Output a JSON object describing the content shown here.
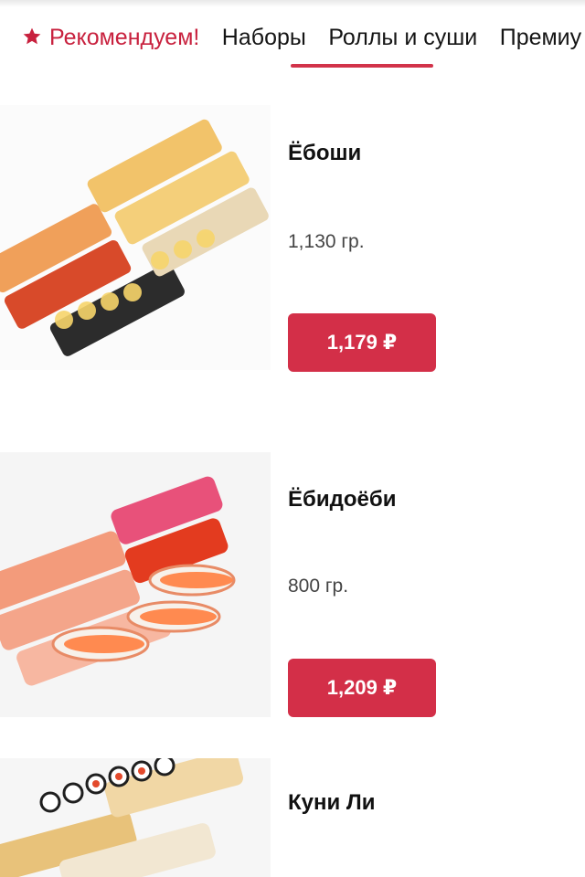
{
  "nav": {
    "tabs": [
      {
        "label": "Рекомендуем!",
        "active": true,
        "icon": "star-icon"
      },
      {
        "label": "Наборы",
        "active": false
      },
      {
        "label": "Роллы и суши",
        "active": false
      },
      {
        "label": "Премиу",
        "active": false
      }
    ]
  },
  "products": [
    {
      "name": "Ёбоши",
      "weight": "1,130 гр.",
      "price": "1,179 ₽"
    },
    {
      "name": "Ёбидоёби",
      "weight": "800 гр.",
      "price": "1,209 ₽"
    },
    {
      "name": "Куни Ли"
    }
  ],
  "colors": {
    "accent": "#d32f48",
    "active_tab": "#c8213e",
    "text": "#151515"
  }
}
